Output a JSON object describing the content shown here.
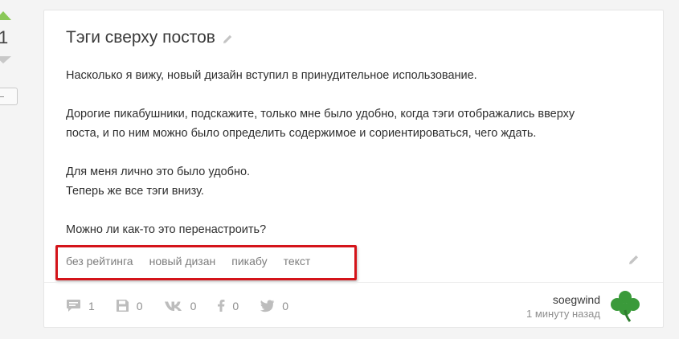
{
  "rating": {
    "count": "1"
  },
  "post": {
    "title": "Тэги сверху постов",
    "paragraphs": {
      "p1": "Насколько я вижу, новый дизайн вступил в принудительное использование.",
      "p2a": "Дорогие пикабушники, подскажите, только мне было удобно, когда тэги отображались вверху",
      "p2b": "поста, и по ним можно было определить содержимое и сориентироваться, чего ждать.",
      "p3a": "Для меня лично это было удобно.",
      "p3b": "Теперь же все тэги внизу.",
      "p4": "Можно ли как-то это перенастроить?"
    },
    "tags": [
      "без рейтинга",
      "новый дизан",
      "пикабу",
      "текст"
    ]
  },
  "footer": {
    "comments": "1",
    "saves": "0",
    "vk": "0",
    "facebook": "0",
    "twitter": "0",
    "author": "soegwind",
    "time": "1 минуту назад"
  },
  "colors": {
    "upvote": "#8ac858",
    "downvote": "#c8c8c8",
    "highlight": "#d4141a",
    "icon": "#bdbdbd",
    "avatar_clover": "#3a9a3a"
  },
  "icons": {
    "comments": "comment-icon",
    "saves": "save-icon",
    "vk": "vk-icon",
    "facebook": "facebook-icon",
    "twitter": "twitter-icon",
    "edit": "pencil-icon"
  }
}
